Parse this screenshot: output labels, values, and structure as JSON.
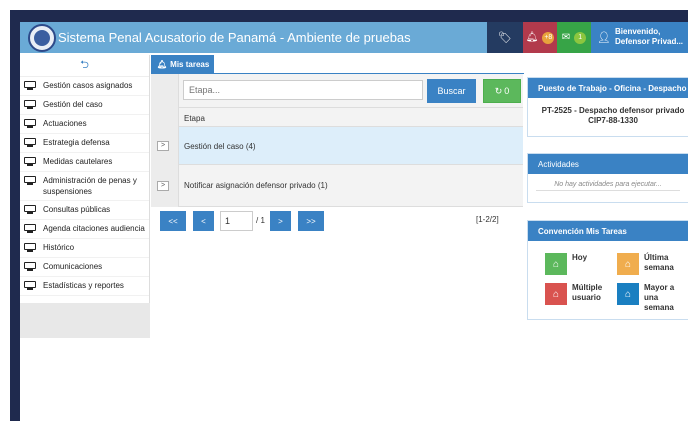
{
  "header": {
    "title": "Sistema Penal Acusatorio de Panamá - Ambiente de pruebas",
    "notifications_count": "+8",
    "messages_count": "1",
    "user_greeting": "Bienvenido,",
    "user_name": "Defensor Privad..."
  },
  "sidebar": {
    "items": [
      {
        "label": "Gestión casos asignados"
      },
      {
        "label": "Gestión del caso"
      },
      {
        "label": "Actuaciones"
      },
      {
        "label": "Estrategia defensa"
      },
      {
        "label": "Medidas cautelares"
      },
      {
        "label": "Administración de penas y suspensiones"
      },
      {
        "label": "Consultas públicas"
      },
      {
        "label": "Agenda citaciones audiencia"
      },
      {
        "label": "Histórico"
      },
      {
        "label": "Comunicaciones"
      },
      {
        "label": "Estadísticas y reportes"
      }
    ]
  },
  "main": {
    "tab_label": "Mis tareas",
    "search_placeholder": "Etapa...",
    "search_button": "Buscar",
    "refresh_count": "0",
    "column_header": "Etapa",
    "rows": [
      {
        "label": "Gestión del caso  (4)"
      },
      {
        "label": "Notificar asignación defensor privado  (1)"
      }
    ],
    "pagination": {
      "first": "<<",
      "prev": "<",
      "page_value": "1",
      "of_total": "/ 1",
      "next": ">",
      "last": ">>",
      "range": "[1-2/2]"
    }
  },
  "right": {
    "puesto_title": "Puesto de Trabajo - Oficina - Despacho",
    "puesto_line1": "PT-2525 - Despacho defensor privado",
    "puesto_line2": "CIP7-88-1330",
    "actividades_title": "Actividades",
    "actividades_empty": "No hay actividades para ejecutar...",
    "convencion_title": "Convención Mis Tareas",
    "convencion": [
      {
        "label": "Hoy",
        "color": "#5cb85c"
      },
      {
        "label": "Última semana",
        "color": "#f0ad4e"
      },
      {
        "label": "Múltiple usuario",
        "color": "#d9534f"
      },
      {
        "label": "Mayor a una semana",
        "color": "#1a7fc1"
      }
    ]
  },
  "colors": {
    "header": "#6aaad6",
    "primary": "#3a82c4",
    "frame": "#1f2a4e"
  }
}
